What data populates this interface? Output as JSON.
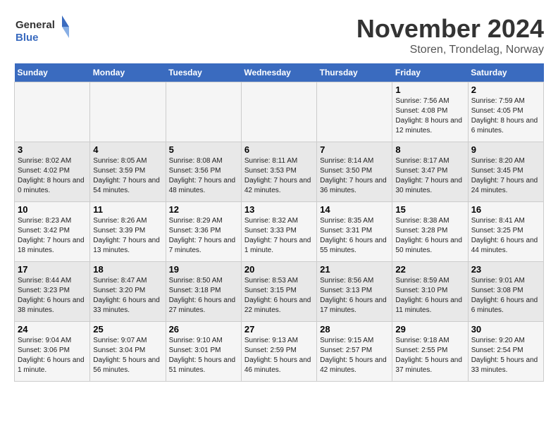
{
  "logo": {
    "text_general": "General",
    "text_blue": "Blue"
  },
  "title": "November 2024",
  "subtitle": "Storen, Trondelag, Norway",
  "weekdays": [
    "Sunday",
    "Monday",
    "Tuesday",
    "Wednesday",
    "Thursday",
    "Friday",
    "Saturday"
  ],
  "weeks": [
    [
      {
        "day": "",
        "info": ""
      },
      {
        "day": "",
        "info": ""
      },
      {
        "day": "",
        "info": ""
      },
      {
        "day": "",
        "info": ""
      },
      {
        "day": "",
        "info": ""
      },
      {
        "day": "1",
        "info": "Sunrise: 7:56 AM\nSunset: 4:08 PM\nDaylight: 8 hours and 12 minutes."
      },
      {
        "day": "2",
        "info": "Sunrise: 7:59 AM\nSunset: 4:05 PM\nDaylight: 8 hours and 6 minutes."
      }
    ],
    [
      {
        "day": "3",
        "info": "Sunrise: 8:02 AM\nSunset: 4:02 PM\nDaylight: 8 hours and 0 minutes."
      },
      {
        "day": "4",
        "info": "Sunrise: 8:05 AM\nSunset: 3:59 PM\nDaylight: 7 hours and 54 minutes."
      },
      {
        "day": "5",
        "info": "Sunrise: 8:08 AM\nSunset: 3:56 PM\nDaylight: 7 hours and 48 minutes."
      },
      {
        "day": "6",
        "info": "Sunrise: 8:11 AM\nSunset: 3:53 PM\nDaylight: 7 hours and 42 minutes."
      },
      {
        "day": "7",
        "info": "Sunrise: 8:14 AM\nSunset: 3:50 PM\nDaylight: 7 hours and 36 minutes."
      },
      {
        "day": "8",
        "info": "Sunrise: 8:17 AM\nSunset: 3:47 PM\nDaylight: 7 hours and 30 minutes."
      },
      {
        "day": "9",
        "info": "Sunrise: 8:20 AM\nSunset: 3:45 PM\nDaylight: 7 hours and 24 minutes."
      }
    ],
    [
      {
        "day": "10",
        "info": "Sunrise: 8:23 AM\nSunset: 3:42 PM\nDaylight: 7 hours and 18 minutes."
      },
      {
        "day": "11",
        "info": "Sunrise: 8:26 AM\nSunset: 3:39 PM\nDaylight: 7 hours and 13 minutes."
      },
      {
        "day": "12",
        "info": "Sunrise: 8:29 AM\nSunset: 3:36 PM\nDaylight: 7 hours and 7 minutes."
      },
      {
        "day": "13",
        "info": "Sunrise: 8:32 AM\nSunset: 3:33 PM\nDaylight: 7 hours and 1 minute."
      },
      {
        "day": "14",
        "info": "Sunrise: 8:35 AM\nSunset: 3:31 PM\nDaylight: 6 hours and 55 minutes."
      },
      {
        "day": "15",
        "info": "Sunrise: 8:38 AM\nSunset: 3:28 PM\nDaylight: 6 hours and 50 minutes."
      },
      {
        "day": "16",
        "info": "Sunrise: 8:41 AM\nSunset: 3:25 PM\nDaylight: 6 hours and 44 minutes."
      }
    ],
    [
      {
        "day": "17",
        "info": "Sunrise: 8:44 AM\nSunset: 3:23 PM\nDaylight: 6 hours and 38 minutes."
      },
      {
        "day": "18",
        "info": "Sunrise: 8:47 AM\nSunset: 3:20 PM\nDaylight: 6 hours and 33 minutes."
      },
      {
        "day": "19",
        "info": "Sunrise: 8:50 AM\nSunset: 3:18 PM\nDaylight: 6 hours and 27 minutes."
      },
      {
        "day": "20",
        "info": "Sunrise: 8:53 AM\nSunset: 3:15 PM\nDaylight: 6 hours and 22 minutes."
      },
      {
        "day": "21",
        "info": "Sunrise: 8:56 AM\nSunset: 3:13 PM\nDaylight: 6 hours and 17 minutes."
      },
      {
        "day": "22",
        "info": "Sunrise: 8:59 AM\nSunset: 3:10 PM\nDaylight: 6 hours and 11 minutes."
      },
      {
        "day": "23",
        "info": "Sunrise: 9:01 AM\nSunset: 3:08 PM\nDaylight: 6 hours and 6 minutes."
      }
    ],
    [
      {
        "day": "24",
        "info": "Sunrise: 9:04 AM\nSunset: 3:06 PM\nDaylight: 6 hours and 1 minute."
      },
      {
        "day": "25",
        "info": "Sunrise: 9:07 AM\nSunset: 3:04 PM\nDaylight: 5 hours and 56 minutes."
      },
      {
        "day": "26",
        "info": "Sunrise: 9:10 AM\nSunset: 3:01 PM\nDaylight: 5 hours and 51 minutes."
      },
      {
        "day": "27",
        "info": "Sunrise: 9:13 AM\nSunset: 2:59 PM\nDaylight: 5 hours and 46 minutes."
      },
      {
        "day": "28",
        "info": "Sunrise: 9:15 AM\nSunset: 2:57 PM\nDaylight: 5 hours and 42 minutes."
      },
      {
        "day": "29",
        "info": "Sunrise: 9:18 AM\nSunset: 2:55 PM\nDaylight: 5 hours and 37 minutes."
      },
      {
        "day": "30",
        "info": "Sunrise: 9:20 AM\nSunset: 2:54 PM\nDaylight: 5 hours and 33 minutes."
      }
    ]
  ]
}
